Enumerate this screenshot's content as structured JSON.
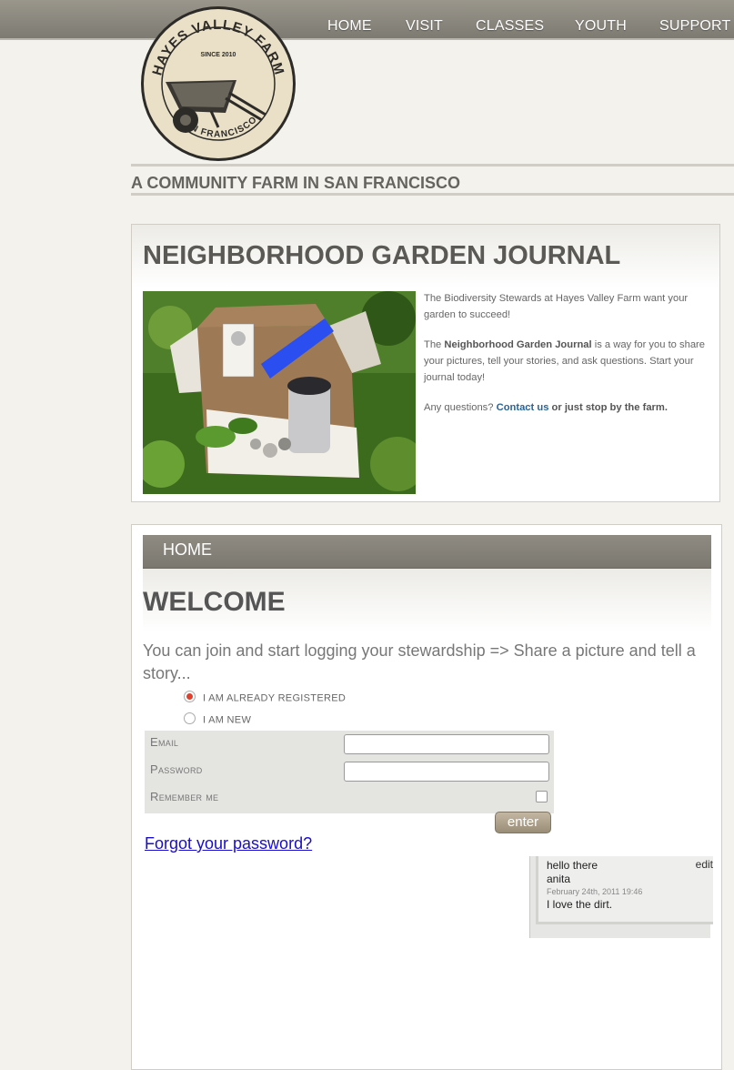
{
  "nav": {
    "items": [
      "HOME",
      "VISIT",
      "CLASSES",
      "YOUTH",
      "SUPPORT"
    ]
  },
  "logo": {
    "name": "HAYES VALLEY FARM",
    "since": "SINCE 2010",
    "city": "SAN FRANCISCO"
  },
  "tagline": "A COMMUNITY FARM IN SAN FRANCISCO",
  "journal": {
    "title": "NEIGHBORHOOD GARDEN JOURNAL",
    "p1": "The Biodiversity Stewards at Hayes Valley Farm want your garden to succeed!",
    "p2_prefix": "The ",
    "p2_bold": "Neighborhood Garden Journal",
    "p2_suffix": " is a way for you to share your pictures, tell your stories, and ask questions. Start your journal today!",
    "p3_prefix": "Any questions?  ",
    "p3_link": "Contact us",
    "p3_suffix": " or just stop by the farm."
  },
  "home": {
    "tab": "HOME",
    "title": "WELCOME",
    "intro": "You can join and start logging your stewardship => Share a picture and tell a story...",
    "radio_registered": "I AM ALREADY REGISTERED",
    "radio_new": "I AM NEW",
    "email_label": "Email",
    "password_label": "Password",
    "remember_label": "Remember me",
    "enter_label": "enter",
    "forgot_label": "Forgot your password?"
  },
  "comment": {
    "title": "hello there",
    "edit": "edit",
    "author": "anita",
    "date": "February 24th, 2011 19:46",
    "body": "I love the dirt."
  },
  "colors": {
    "nav_bg": "#7d7a72",
    "accent_link": "#2a6496",
    "radio_selected": "#e0412e"
  }
}
